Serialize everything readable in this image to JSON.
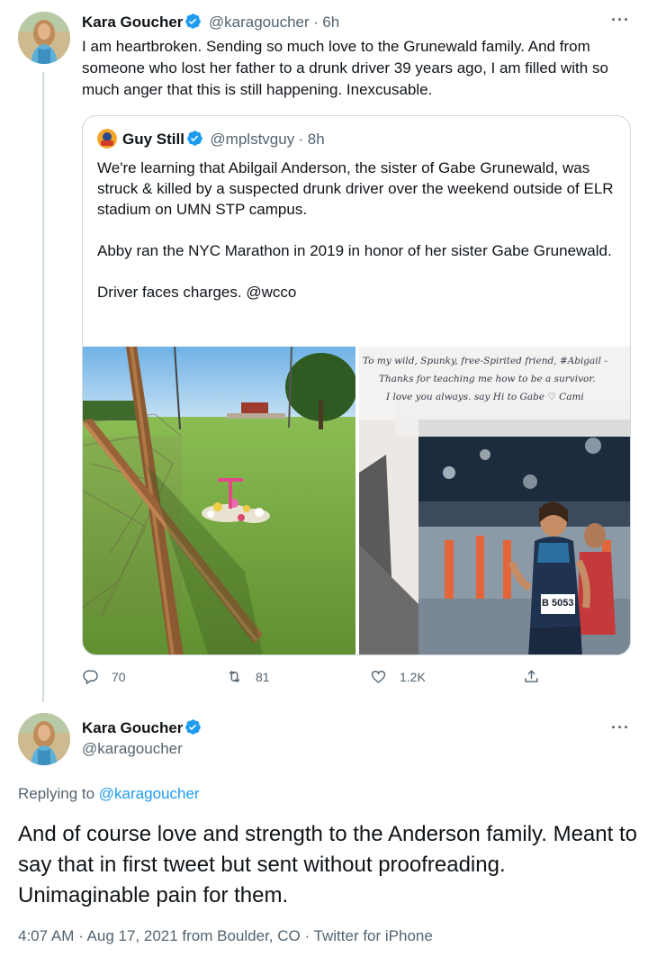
{
  "tweet1": {
    "author_name": "Kara Goucher",
    "author_handle": "@karagoucher",
    "separator": "·",
    "time": "6h",
    "text": "I am heartbroken. Sending so much love to the Grunewald family. And from someone who lost her father to a drunk driver 39 years ago, I am filled with so much anger that this is still happening. Inexcusable.",
    "quote": {
      "author_name": "Guy Still",
      "author_handle": "@mplstvguy",
      "separator": "·",
      "time": "8h",
      "paragraphs": [
        "We're learning that Abilgail Anderson, the sister of Gabe Grunewald, was struck & killed by a suspected drunk driver over the weekend outside of ELR stadium on UMN STP campus.",
        "Abby ran the NYC Marathon in 2019 in honor of her sister Gabe Grunewald.",
        "Driver faces charges. @wcco"
      ],
      "photo_note": {
        "line1": "To my wild, Spunky, free-Spirited friend, #Abigail -",
        "line2": "Thanks for teaching me how to be a survivor.",
        "line3": "I love you always. say Hi to Gabe ♡ Cami",
        "bib": "B 5053"
      }
    },
    "actions": {
      "replies": "70",
      "retweets": "81",
      "likes": "1.2K"
    }
  },
  "tweet2": {
    "author_name": "Kara Goucher",
    "author_handle": "@karagoucher",
    "replying_prefix": "Replying to",
    "replying_to": "@karagoucher",
    "text": "And of course love and strength to the Anderson family. Meant to say that in first tweet but sent without proofreading. Unimaginable pain for them.",
    "timestamp": "4:07 AM · Aug 17, 2021 from Boulder, CO · Twitter for iPhone"
  },
  "colors": {
    "verified": "#1d9bf0",
    "link": "#1d9bf0",
    "secondary_text": "#536471",
    "border": "#cfd9de"
  },
  "icons": [
    "verified-badge-icon",
    "more-options-icon",
    "reply-icon",
    "retweet-icon",
    "like-icon",
    "share-icon"
  ]
}
